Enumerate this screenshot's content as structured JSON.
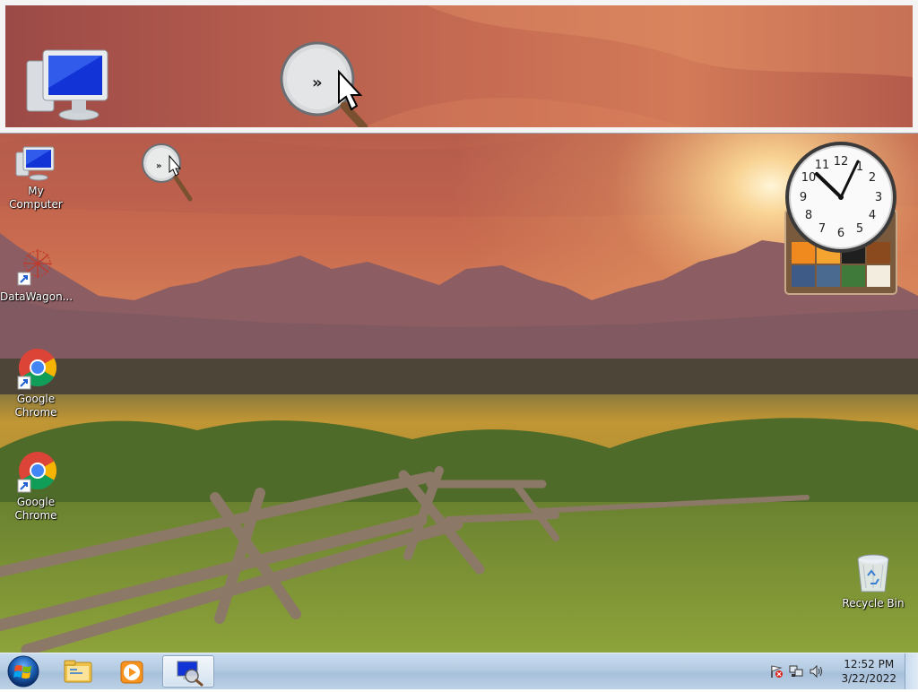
{
  "desktop": {
    "icons": [
      {
        "name": "My Computer",
        "label_lines": [
          "My Computer"
        ],
        "icon": "computer-icon"
      },
      {
        "name": "DataWagon",
        "label_lines": [
          "DataWagon..."
        ],
        "icon": "datawagon-shortcut-icon"
      },
      {
        "name": "Google Chrome 1",
        "label_lines": [
          "Google",
          "Chrome"
        ],
        "icon": "chrome-shortcut-icon"
      },
      {
        "name": "Google Chrome 2",
        "label_lines": [
          "Google",
          "Chrome"
        ],
        "icon": "chrome-shortcut-icon"
      },
      {
        "name": "Recycle Bin",
        "label_lines": [
          "Recycle Bin"
        ],
        "icon": "recycle-bin-icon"
      }
    ],
    "wallpaper": "mountain-sunset-fence-meadow"
  },
  "magnifier": {
    "state": "docked",
    "icons": [
      "computer-icon",
      "magnifier-cursor-icon"
    ]
  },
  "gadgets": {
    "clock": {
      "numerals": [
        "12",
        "1",
        "2",
        "3",
        "4",
        "5",
        "6",
        "7",
        "8",
        "9",
        "10",
        "11"
      ],
      "time_shown": "12:52"
    },
    "puzzle": {
      "icon": "picture-puzzle-icon"
    }
  },
  "taskbar": {
    "start": {
      "icon": "windows-start-icon"
    },
    "pinned": [
      {
        "icon": "explorer-folder-icon",
        "active": false
      },
      {
        "icon": "media-player-icon",
        "active": false
      },
      {
        "icon": "magnifier-app-icon",
        "active": true
      }
    ],
    "tray": {
      "icons": [
        "action-center-flag-icon",
        "network-icon",
        "volume-icon"
      ],
      "time": "12:52 PM",
      "date": "3/22/2022"
    }
  },
  "colors": {
    "sky_top": "#b9614c",
    "sky_glow": "#f6c070",
    "mountain": "#8a5f63",
    "meadow": "#b8942f",
    "grass": "#5f7c2a",
    "taskbar": "#b4cbe2"
  }
}
